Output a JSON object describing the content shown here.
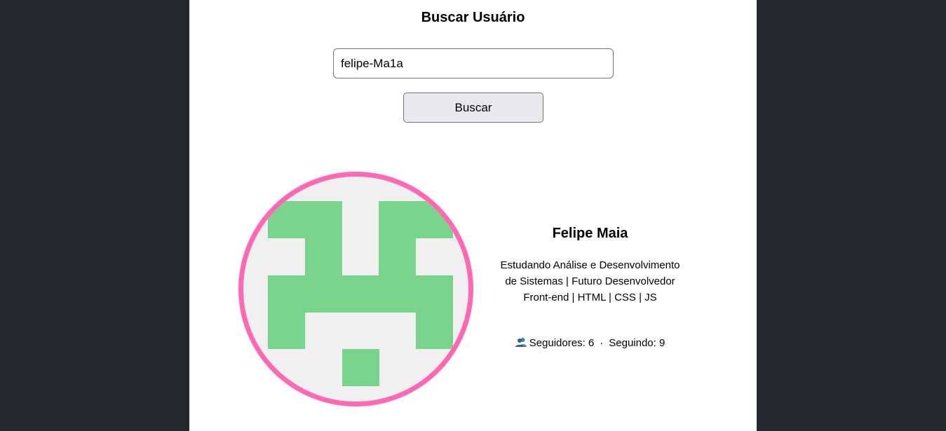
{
  "header": {
    "title": "Buscar Usuário"
  },
  "search": {
    "value": "felipe-Ma1a",
    "button_label": "Buscar"
  },
  "profile": {
    "name": "Felipe Maia",
    "bio": "Estudando Análise e Desenvolvimento de Sistemas | Futuro Desenvolvedor Front-end | HTML | CSS | JS",
    "followers_label": "Seguidores: 6",
    "separator": "·",
    "following_label": "Seguindo: 9",
    "stats_icon": "people-icon",
    "avatar_border_color": "#ff69b4",
    "identicon_color": "#79d38d",
    "identicon_background": "#f0f0f0"
  }
}
